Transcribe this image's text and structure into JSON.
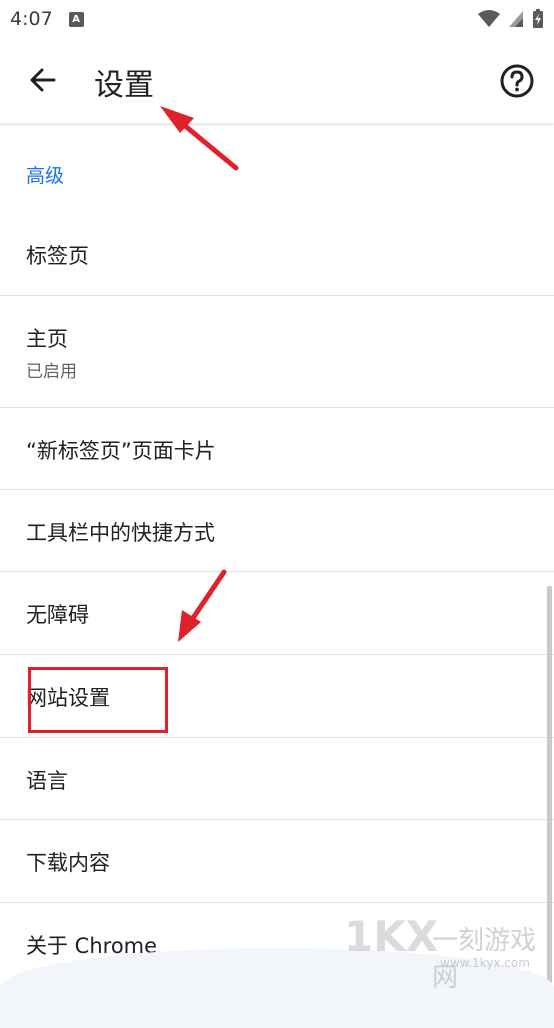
{
  "status_bar": {
    "time": "4:07",
    "notification_glyph": "A"
  },
  "app_bar": {
    "title": "设置"
  },
  "section": {
    "header": "高级"
  },
  "items": [
    {
      "title": "标签页"
    },
    {
      "title": "主页",
      "subtitle": "已启用"
    },
    {
      "title": "“新标签页”页面卡片"
    },
    {
      "title": "工具栏中的快捷方式"
    },
    {
      "title": "无障碍"
    },
    {
      "title": "网站设置"
    },
    {
      "title": "语言"
    },
    {
      "title": "下载内容"
    },
    {
      "title": "关于 Chrome"
    }
  ],
  "watermark": {
    "logo": "1KX",
    "name": "一刻游戏网",
    "url": "www.1kyx.com"
  },
  "colors": {
    "accent": "#1a73e8",
    "annotation": "#e0202a",
    "divider": "#e0e0e0"
  }
}
